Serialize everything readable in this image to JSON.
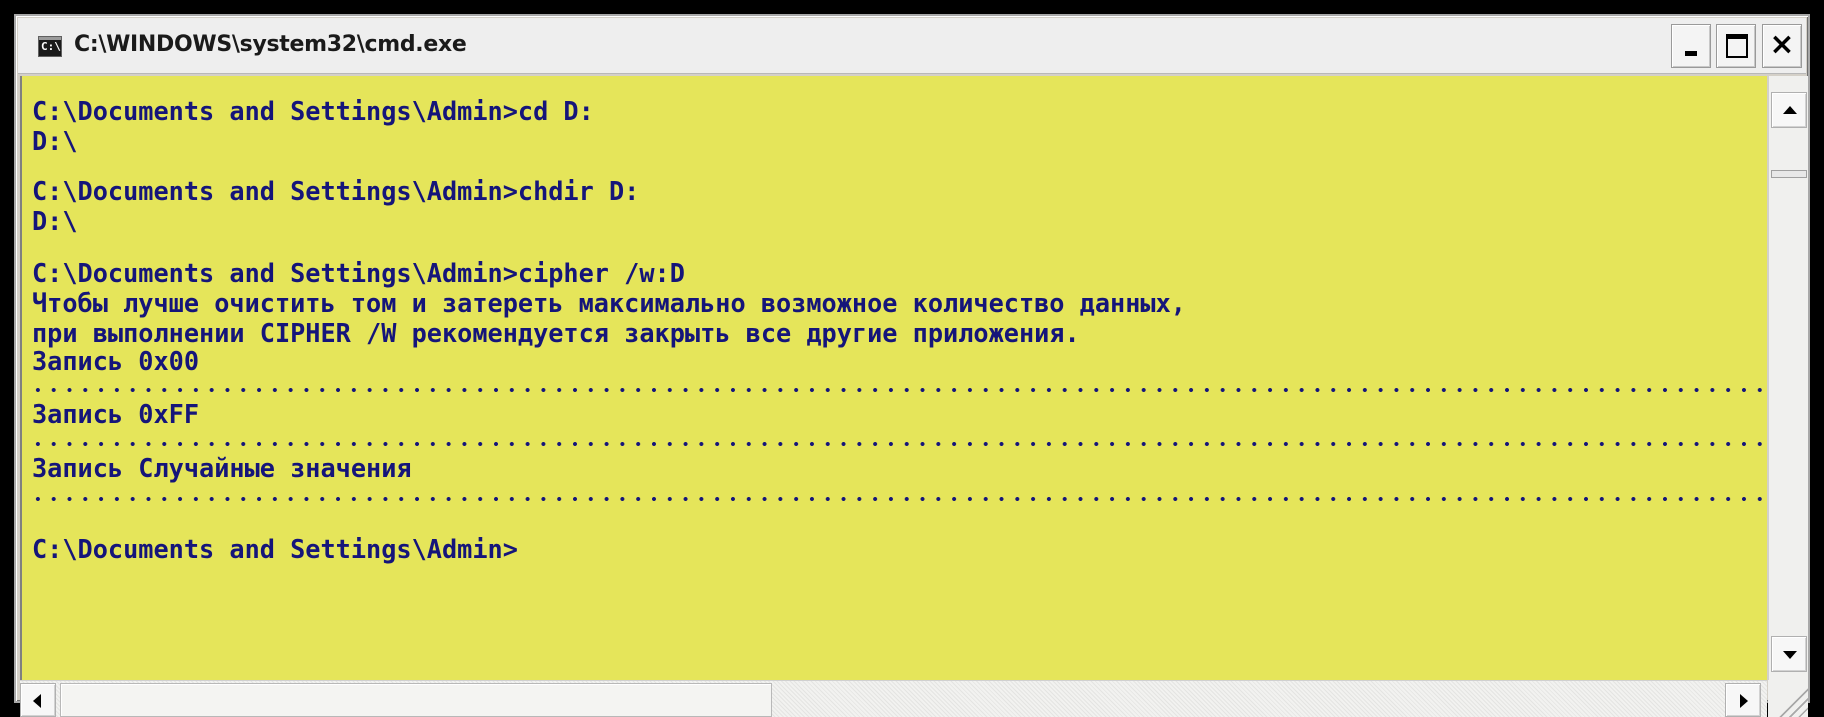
{
  "window": {
    "title": "C:\\WINDOWS\\system32\\cmd.exe",
    "icon_name": "console-app-icon",
    "icon_text": "C:\\",
    "controls": {
      "minimize": "minimize-icon",
      "maximize": "maximize-icon",
      "close": "×"
    }
  },
  "console": {
    "background": "#e5e55a",
    "text_color": "#15157a",
    "lines": [
      "C:\\Documents and Settings\\Admin>cd D:",
      "D:\\",
      "",
      "C:\\Documents and Settings\\Admin>chdir D:",
      "D:\\",
      "",
      "C:\\Documents and Settings\\Admin>cipher /w:D",
      "Чтобы лучше очистить том и затереть максимально возможное количество данных,",
      "при выполнении CIPHER /W рекомендуется закрыть все другие приложения.",
      "Запись 0x00",
      "Запись 0xFF",
      "Запись Случайные значения",
      "C:\\Documents and Settings\\Admin>"
    ]
  },
  "scrollbars": {
    "vertical": {
      "up_icon": "arrow-up-icon",
      "down_icon": "arrow-down-icon"
    },
    "horizontal": {
      "left_icon": "arrow-left-icon",
      "right_icon": "arrow-right-icon"
    }
  }
}
